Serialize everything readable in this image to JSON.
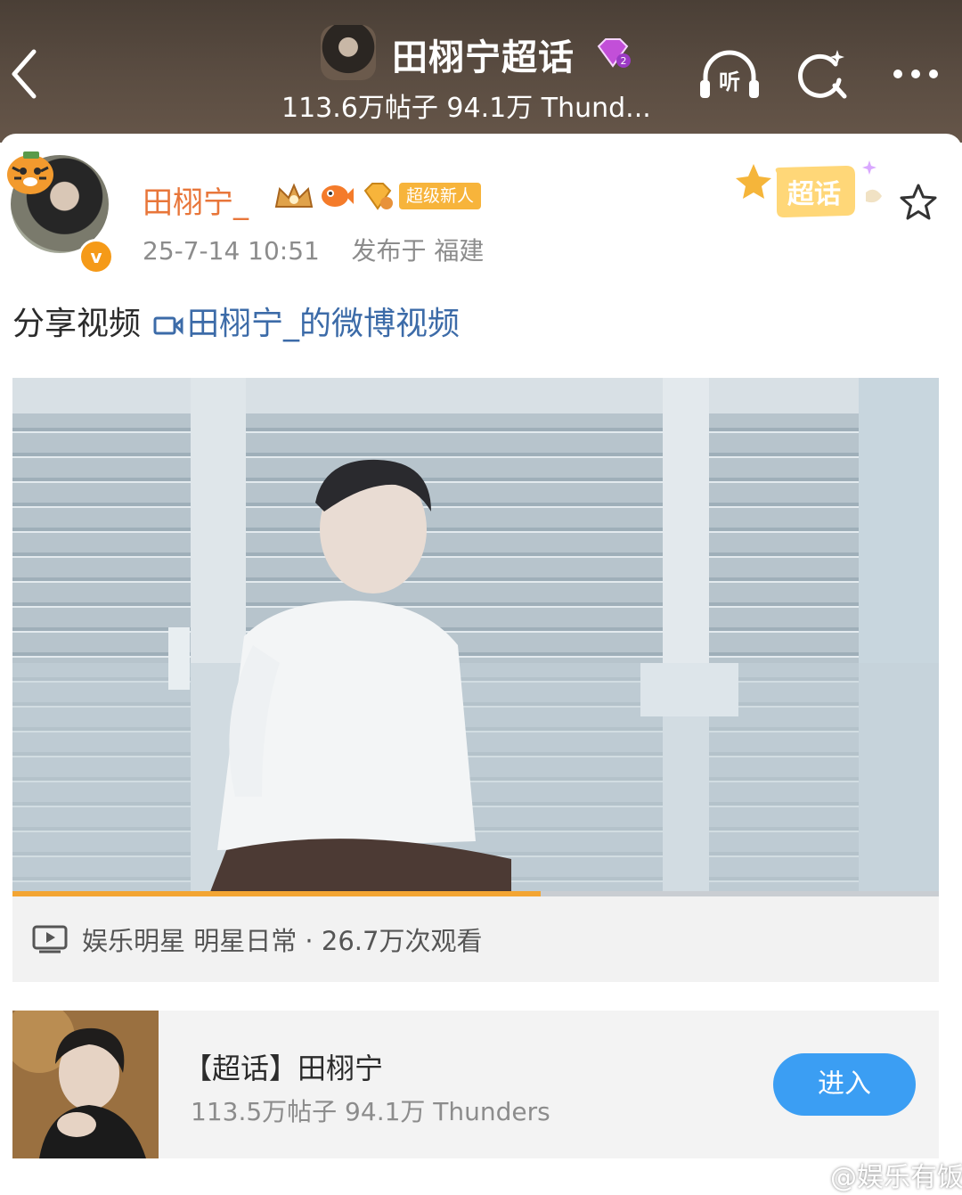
{
  "header": {
    "title": "田栩宁超话",
    "subtitle": "113.6万帖子 94.1万 Thund...",
    "listen_label": "听",
    "icons": [
      "back-icon",
      "listen-icon",
      "search-icon",
      "more-icon"
    ]
  },
  "post": {
    "username": "田栩宁_",
    "badge_label": "超级新人",
    "timestamp": "25-7-14 10:51",
    "location": "发布于 福建",
    "tag_label": "超话",
    "text_prefix": "分享视频",
    "video_link": "田栩宁_的微博视频"
  },
  "video": {
    "progress_percent": 57,
    "info": "娱乐明星 明星日常 · 26.7万次观看"
  },
  "topic": {
    "title": "【超话】田栩宁",
    "stats": "113.5万帖子 94.1万 Thunders",
    "enter_label": "进入"
  },
  "watermark": "@娱乐有饭",
  "colors": {
    "header_bg": "#5b4d42",
    "username": "#e8763a",
    "link": "#3c6ba8",
    "enter_button": "#3b9ef3",
    "progress": "#f3a533"
  }
}
